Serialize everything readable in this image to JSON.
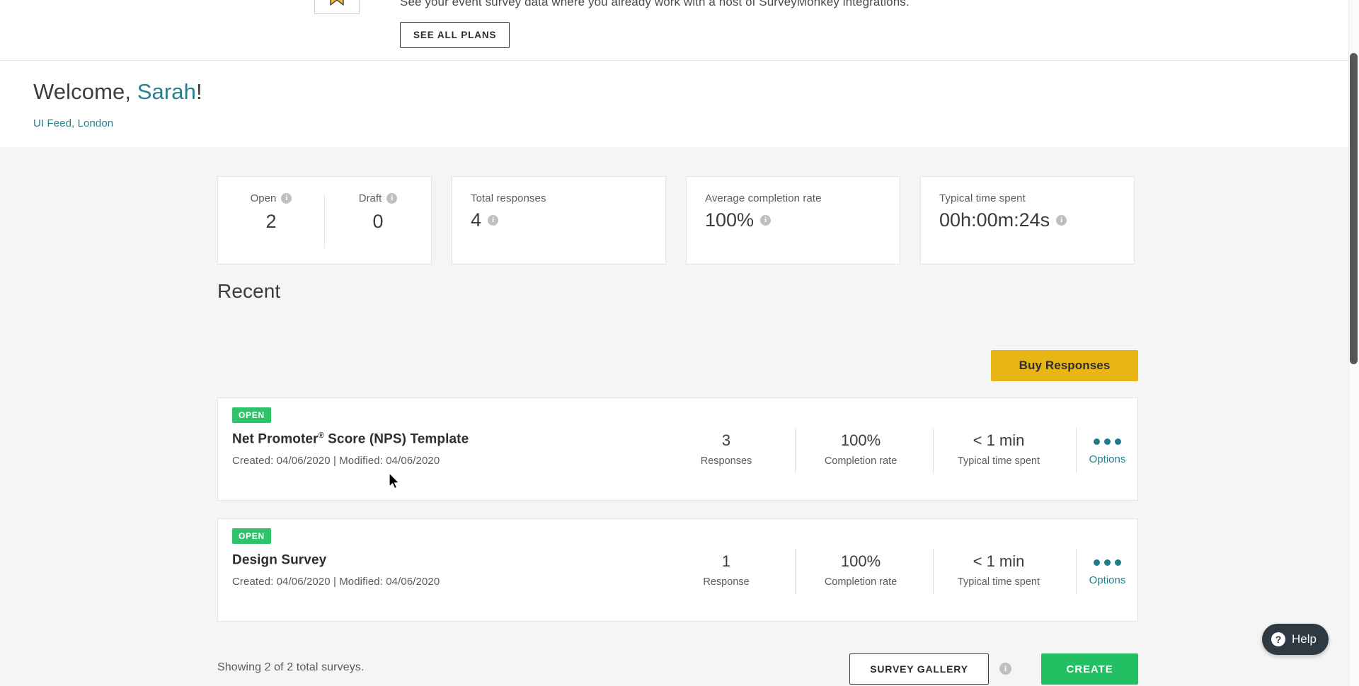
{
  "promo": {
    "text": "See your event survey data where you already work with a host of SurveyMonkey integrations.",
    "cta_label": "SEE ALL PLANS",
    "badge_icon": "ribbon-star-icon"
  },
  "welcome": {
    "greeting_prefix": "Welcome, ",
    "user_name": "Sarah",
    "greeting_suffix": "!",
    "org_location": "UI Feed, London"
  },
  "stats": {
    "open": {
      "label": "Open",
      "value": "2",
      "info_icon": "info-icon"
    },
    "draft": {
      "label": "Draft",
      "value": "0",
      "info_icon": "info-icon"
    },
    "total_responses": {
      "label": "Total responses",
      "value": "4",
      "info_icon": "info-icon"
    },
    "average_completion_rate": {
      "label": "Average completion rate",
      "value": "100%",
      "info_icon": "info-icon"
    },
    "typical_time_spent": {
      "label": "Typical time spent",
      "value": "00h:00m:24s",
      "info_icon": "info-icon"
    }
  },
  "recent": {
    "heading": "Recent",
    "buy_responses_label": "Buy Responses",
    "surveys": [
      {
        "status": "OPEN",
        "title": "Net Promoter® Score (NPS) Template",
        "title_main": "Net Promoter",
        "title_sup": "®",
        "title_rest": " Score (NPS) Template",
        "dates": "Created: 04/06/2020   |   Modified: 04/06/2020",
        "responses_value": "3",
        "responses_label": "Responses",
        "completion_value": "100%",
        "completion_label": "Completion rate",
        "time_value": "< 1 min",
        "time_label": "Typical time spent",
        "options_label": "Options"
      },
      {
        "status": "OPEN",
        "title": "Design Survey",
        "title_main": "Design Survey",
        "title_sup": "",
        "title_rest": "",
        "dates": "Created: 04/06/2020   |   Modified: 04/06/2020",
        "responses_value": "1",
        "responses_label": "Response",
        "completion_value": "100%",
        "completion_label": "Completion rate",
        "time_value": "< 1 min",
        "time_label": "Typical time spent",
        "options_label": "Options"
      }
    ]
  },
  "footer": {
    "showing_text": "Showing 2 of 2 total surveys.",
    "survey_gallery_label": "SURVEY GALLERY",
    "create_label": "CREATE",
    "gallery_info_icon": "info-icon"
  },
  "help": {
    "label": "Help",
    "icon": "question-mark-icon"
  },
  "colors": {
    "teal_link": "#2a7f8e",
    "status_green": "#2ec26a",
    "create_green": "#22c062",
    "buy_yellow": "#e8b514",
    "help_dark": "#2f3943"
  }
}
